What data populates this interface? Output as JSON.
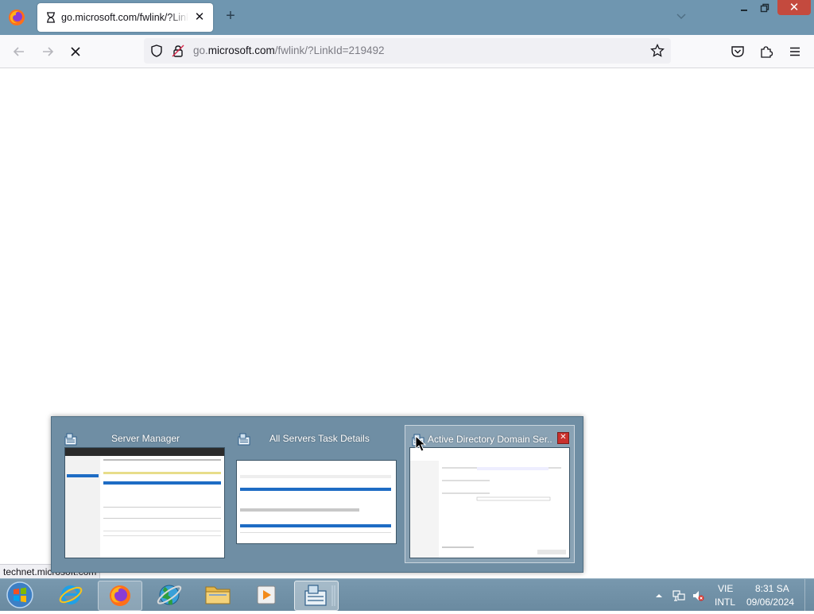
{
  "browser": {
    "tab": {
      "title": "go.microsoft.com/fwlink/?LinkId=219492"
    },
    "url": {
      "prefix": "go.",
      "domain": "microsoft.com",
      "path": "/fwlink/?LinkId=219492"
    },
    "status_url": "technet.microsoft.com"
  },
  "thumbnails": [
    {
      "title": "Server Manager"
    },
    {
      "title": "All Servers Task Details"
    },
    {
      "title": "Active Directory Domain Ser..."
    }
  ],
  "tray": {
    "language_top": "VIE",
    "language_bottom": "INTL",
    "time": "8:31 SA",
    "date": "09/06/2024"
  },
  "colors": {
    "chrome": "#6f96b0",
    "taskbar": "#6a8aa0",
    "close": "#c44a3e"
  }
}
